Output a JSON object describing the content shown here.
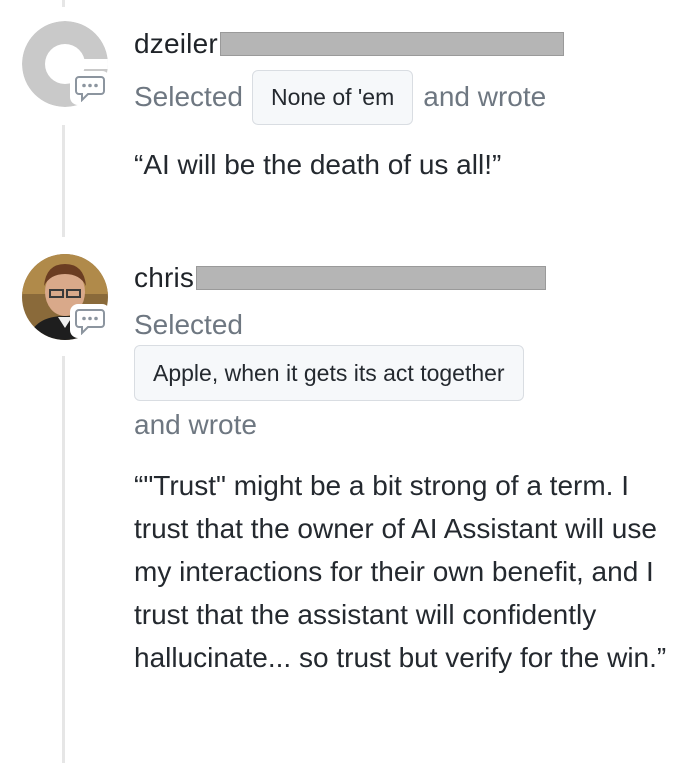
{
  "comments": [
    {
      "username_visible": "dzeiler",
      "selected_label": "Selected",
      "choice": "None of 'em",
      "wrote_label": "and wrote",
      "quote": "“AI will be the death of us all!”"
    },
    {
      "username_visible": "chris",
      "selected_label": "Selected",
      "choice": "Apple, when it gets its act together",
      "wrote_label": "and wrote",
      "quote": "“\"Trust\" might be a bit strong of a term. I trust that the owner of AI Assistant will use my interactions for their own benefit, and I trust that the assistant will confidently hallucinate... so trust but verify for the win.”"
    }
  ],
  "icons": {
    "comment_badge": "speech-bubble-icon",
    "default_avatar": "default-avatar-icon"
  },
  "colors": {
    "text": "#24292f",
    "muted": "#6e7781",
    "chip_bg": "#f6f8fa",
    "thread_line": "#e6e6e6",
    "redaction": "#b5b5b5"
  }
}
